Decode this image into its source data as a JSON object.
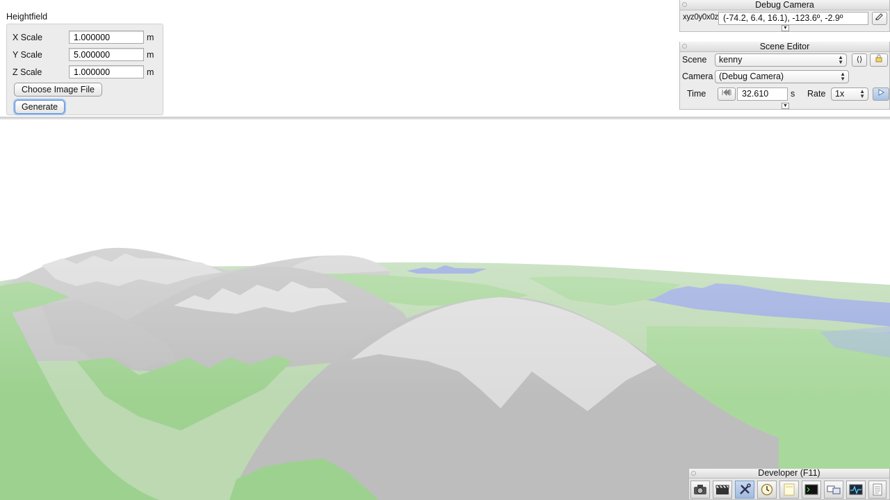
{
  "heightfield": {
    "title": "Heightfield",
    "fields": [
      {
        "label": "X Scale",
        "value": "1.000000",
        "unit": "m"
      },
      {
        "label": "Y Scale",
        "value": "5.000000",
        "unit": "m"
      },
      {
        "label": "Z Scale",
        "value": "1.000000",
        "unit": "m"
      }
    ],
    "choose_button": "Choose Image File",
    "generate_button": "Generate"
  },
  "debug_camera": {
    "title": "Debug Camera",
    "mode_label": "xyz0y0x0z",
    "coords": "(-74.2,   6.4,  16.1), -123.6º,  -2.9º"
  },
  "scene_editor": {
    "title": "Scene Editor",
    "scene_label": "Scene",
    "scene_value": "kenny",
    "camera_label": "Camera",
    "camera_value": "(Debug Camera)",
    "time_label": "Time",
    "time_value": "32.610",
    "time_unit": "s",
    "rate_label": "Rate",
    "rate_value": "1x"
  },
  "developer_toolbar": {
    "title": "Developer (F11)",
    "icons": [
      "camera-icon",
      "clapperboard-icon",
      "tools-icon",
      "clock-icon",
      "note-icon",
      "terminal-icon",
      "windows-icon",
      "activity-monitor-icon",
      "document-icon"
    ]
  },
  "colors": {
    "grass": "#9bd08c",
    "rock": "#b9b9b9",
    "snow": "#dcdcdc",
    "water": "#8fa3dc",
    "accent": "#5a8fd6"
  }
}
